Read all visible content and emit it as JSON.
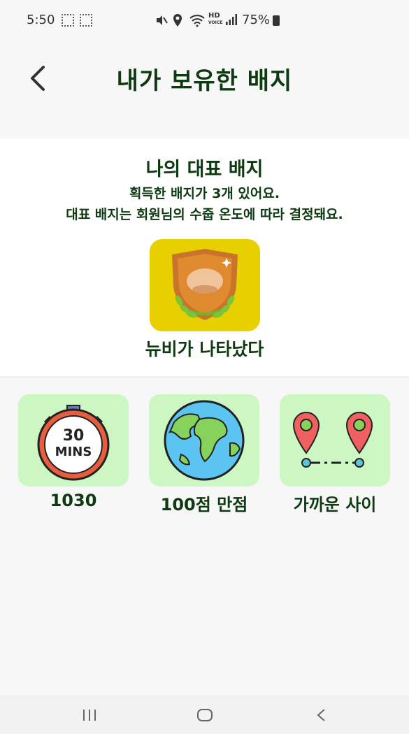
{
  "status": {
    "time": "5:50",
    "battery": "75%",
    "icons": [
      "screenshot-icon",
      "screen-record-icon",
      "mute-icon",
      "location-icon",
      "wifi-icon",
      "hd-voice-icon",
      "signal-icon",
      "battery-icon"
    ]
  },
  "header": {
    "title": "내가 보유한 배지"
  },
  "representative": {
    "title": "나의 대표 배지",
    "subtitle1": "획득한 배지가 3개 있어요.",
    "subtitle2": "대표 배지는 회원님의 수줍 온도에 따라 결정돼요.",
    "badge_name": "뉴비가 나타났다",
    "badge_icon": "bronze-shield-laurel-icon",
    "badge_bg": "#e8cf00"
  },
  "badges": [
    {
      "label": "1030",
      "icon": "stopwatch-30-mins-icon",
      "bg": "#ccf7c3"
    },
    {
      "label": "100점 만점",
      "icon": "earth-globe-icon",
      "bg": "#ccf7c3"
    },
    {
      "label": "가까운 사이",
      "icon": "two-location-pins-icon",
      "bg": "#ccf7c3"
    }
  ],
  "stopwatch_text": {
    "top": "30",
    "bottom": "MINS"
  },
  "nav": {
    "buttons": [
      "recent-apps",
      "home",
      "back"
    ]
  }
}
